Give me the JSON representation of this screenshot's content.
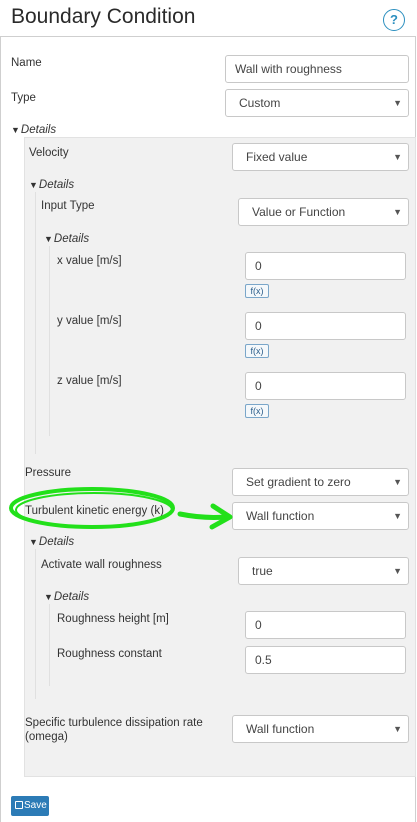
{
  "header": {
    "title": "Boundary Condition",
    "help_label": "?"
  },
  "form": {
    "name_label": "Name",
    "name_value": "Wall with roughness",
    "type_label": "Type",
    "type_value": "Custom",
    "details_label": "Details"
  },
  "velocity": {
    "label": "Velocity",
    "value": "Fixed value",
    "details_label": "Details",
    "input_type_label": "Input Type",
    "input_type_value": "Value or Function",
    "inner_details_label": "Details",
    "x_label": "x value [m/s]",
    "x_value": "0",
    "y_label": "y value [m/s]",
    "y_value": "0",
    "z_label": "z value [m/s]",
    "z_value": "0",
    "fx_label": "f(x)"
  },
  "pressure": {
    "label": "Pressure",
    "value": "Set gradient to zero"
  },
  "tke": {
    "label": "Turbulent kinetic energy (k)",
    "value": "Wall function",
    "details_label": "Details",
    "roughness_label": "Activate wall roughness",
    "roughness_value": "true",
    "inner_details_label": "Details",
    "height_label": "Roughness height [m]",
    "height_value": "0",
    "constant_label": "Roughness constant",
    "constant_value": "0.5"
  },
  "omega": {
    "label_line1": "Specific turbulence dissipation rate",
    "label_line2": "(omega)",
    "value": "Wall function"
  },
  "footer": {
    "save_label": "Save"
  },
  "colors": {
    "annotation_green": "#22e01a",
    "accent_blue": "#2c7bb6"
  },
  "icons": {
    "save": "floppy-disk-icon",
    "dropdown": "caret-down-icon",
    "collapse": "triangle-down-icon"
  }
}
